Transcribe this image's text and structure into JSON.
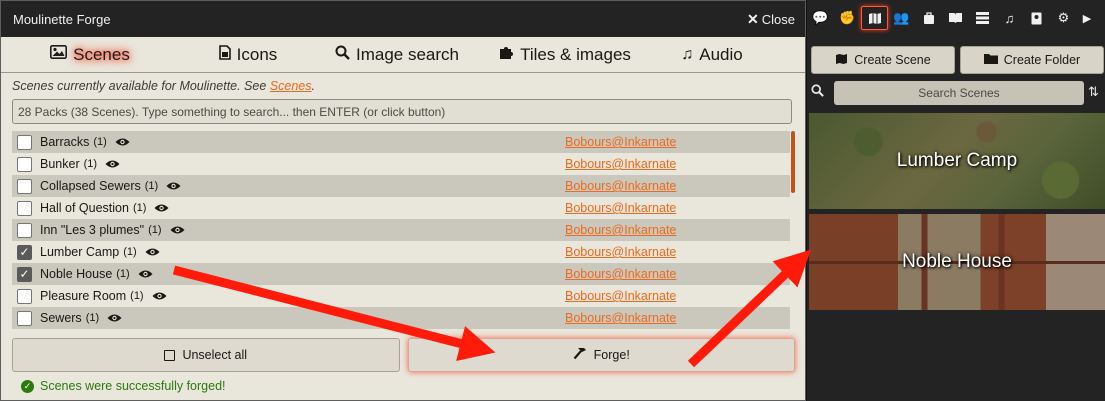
{
  "window": {
    "title": "Moulinette Forge",
    "close_label": "Close"
  },
  "tabs": [
    {
      "label": "Scenes",
      "icon": "image-icon"
    },
    {
      "label": "Icons",
      "icon": "file-icon"
    },
    {
      "label": "Image search",
      "icon": "search-icon"
    },
    {
      "label": "Tiles & images",
      "icon": "puzzle-icon"
    },
    {
      "label": "Audio",
      "icon": "music-icon"
    }
  ],
  "intro": {
    "text": "Scenes currently available for Moulinette. See ",
    "link": "Scenes",
    "suffix": "."
  },
  "search": {
    "placeholder": "28 Packs (38 Scenes). Type something to search... then ENTER (or click button)"
  },
  "scenes": [
    {
      "name": "Barracks",
      "count": "(1)",
      "checked": false,
      "author": "Bobours@Inkarnate"
    },
    {
      "name": "Bunker",
      "count": "(1)",
      "checked": false,
      "author": "Bobours@Inkarnate"
    },
    {
      "name": "Collapsed Sewers",
      "count": "(1)",
      "checked": false,
      "author": "Bobours@Inkarnate"
    },
    {
      "name": "Hall of Question",
      "count": "(1)",
      "checked": false,
      "author": "Bobours@Inkarnate"
    },
    {
      "name": "Inn \"Les 3 plumes\"",
      "count": "(1)",
      "checked": false,
      "author": "Bobours@Inkarnate"
    },
    {
      "name": "Lumber Camp",
      "count": "(1)",
      "checked": true,
      "author": "Bobours@Inkarnate"
    },
    {
      "name": "Noble House",
      "count": "(1)",
      "checked": true,
      "author": "Bobours@Inkarnate"
    },
    {
      "name": "Pleasure Room",
      "count": "(1)",
      "checked": false,
      "author": "Bobours@Inkarnate"
    },
    {
      "name": "Sewers",
      "count": "(1)",
      "checked": false,
      "author": "Bobours@Inkarnate"
    }
  ],
  "actions": {
    "unselect_label": "Unselect all",
    "forge_label": "Forge!"
  },
  "status": {
    "message": "Scenes were successfully forged!",
    "color": "#2b7a0b"
  },
  "sidebar": {
    "tabs": [
      "chat-icon",
      "fist-icon",
      "map-icon",
      "users-icon",
      "suitcase-icon",
      "book-icon",
      "list-icon",
      "music-icon",
      "journal-icon",
      "cogs-icon",
      "chevron-right-icon"
    ],
    "create_scene_label": "Create Scene",
    "create_folder_label": "Create Folder",
    "search_placeholder": "Search Scenes",
    "scene_cards": [
      {
        "title": "Lumber Camp"
      },
      {
        "title": "Noble House"
      }
    ]
  },
  "colors": {
    "accent": "#ef6a1d",
    "glow": "#ff3b1f",
    "arrow": "#ff1a0a"
  }
}
